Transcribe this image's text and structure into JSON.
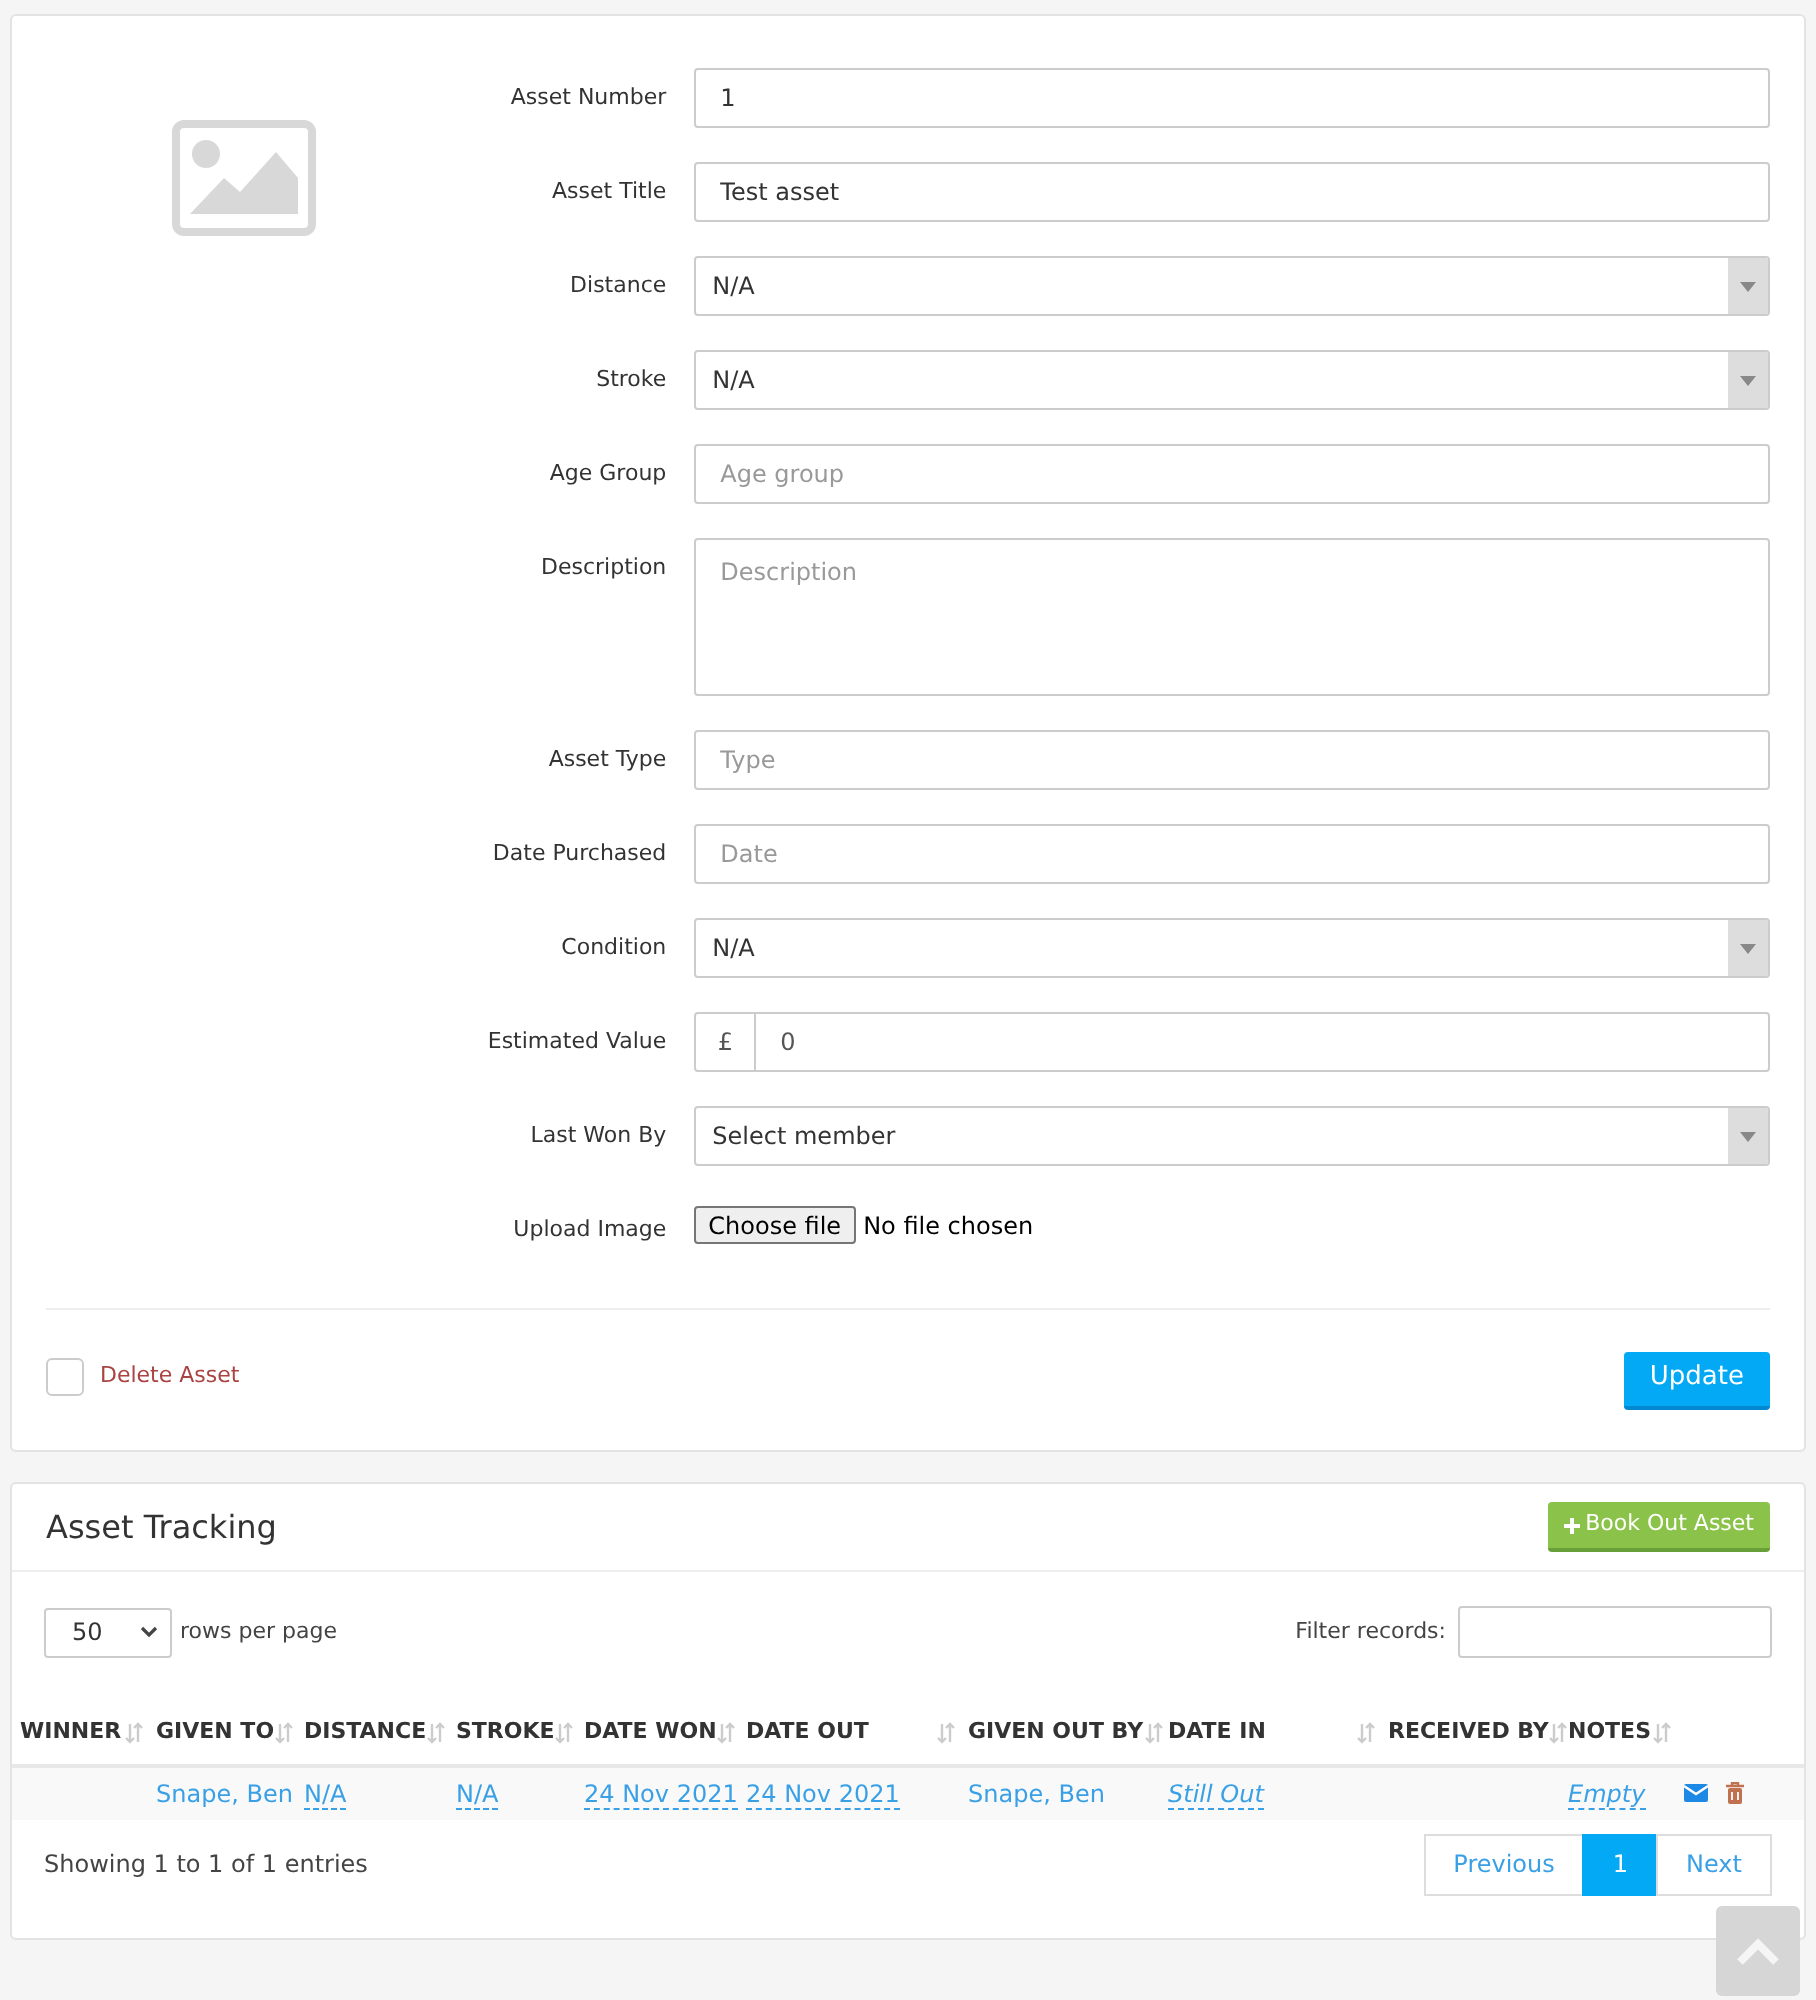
{
  "asset_form": {
    "fields": [
      {
        "label": "Asset Number",
        "kind": "text",
        "value": "1"
      },
      {
        "label": "Asset Title",
        "kind": "text",
        "value": "Test asset"
      },
      {
        "label": "Distance",
        "kind": "select",
        "value": "N/A"
      },
      {
        "label": "Stroke",
        "kind": "select",
        "value": "N/A"
      },
      {
        "label": "Age Group",
        "kind": "text",
        "placeholder": "Age group"
      },
      {
        "label": "Description",
        "kind": "textarea",
        "placeholder": "Description"
      },
      {
        "label": "Asset Type",
        "kind": "text",
        "placeholder": "Type"
      },
      {
        "label": "Date Purchased",
        "kind": "text",
        "placeholder": "Date"
      },
      {
        "label": "Condition",
        "kind": "select",
        "value": "N/A"
      },
      {
        "label": "Estimated Value",
        "kind": "money",
        "prefix": "£",
        "value": "0"
      },
      {
        "label": "Last Won By",
        "kind": "select",
        "value": "Select member"
      },
      {
        "label": "Upload Image",
        "kind": "file",
        "button": "Choose file",
        "status": "No file chosen"
      }
    ],
    "delete": {
      "label": "Delete Asset",
      "checked": false
    },
    "submit": "Update"
  },
  "tracking": {
    "title": "Asset Tracking",
    "action": "Book Out Asset",
    "page_size": "50",
    "page_size_label": "rows per page",
    "filter_label": "Filter records:",
    "columns": [
      {
        "label": "WINNER",
        "sortable": true
      },
      {
        "label": "GIVEN TO",
        "sortable": true
      },
      {
        "label": "DISTANCE",
        "sortable": true
      },
      {
        "label": "STROKE",
        "sortable": true
      },
      {
        "label": "DATE WON",
        "sortable": true
      },
      {
        "label": "DATE OUT",
        "sortable": true
      },
      {
        "label": "GIVEN OUT BY",
        "sortable": true
      },
      {
        "label": "DATE IN",
        "sortable": true
      },
      {
        "label": "RECEIVED BY",
        "sortable": true
      },
      {
        "label": "NOTES",
        "sortable": true
      }
    ],
    "rows": [
      {
        "cells": [
          {
            "kind": "blank"
          },
          {
            "kind": "link",
            "text": "Snape, Ben"
          },
          {
            "kind": "editable",
            "text": "N/A"
          },
          {
            "kind": "editable",
            "text": "N/A"
          },
          {
            "kind": "editable",
            "text": "24 Nov 2021"
          },
          {
            "kind": "editable",
            "text": "24 Nov 2021"
          },
          {
            "kind": "link",
            "text": "Snape, Ben"
          },
          {
            "kind": "empty-edit",
            "text": "Still Out"
          },
          {
            "kind": "blank"
          },
          {
            "kind": "empty-edit",
            "text": "Empty"
          }
        ]
      }
    ],
    "summary": "Showing 1 to 1 of 1 entries",
    "pagination": [
      {
        "label": "Previous",
        "selected": false
      },
      {
        "label": "1",
        "selected": true
      },
      {
        "label": "Next",
        "selected": false
      }
    ]
  }
}
